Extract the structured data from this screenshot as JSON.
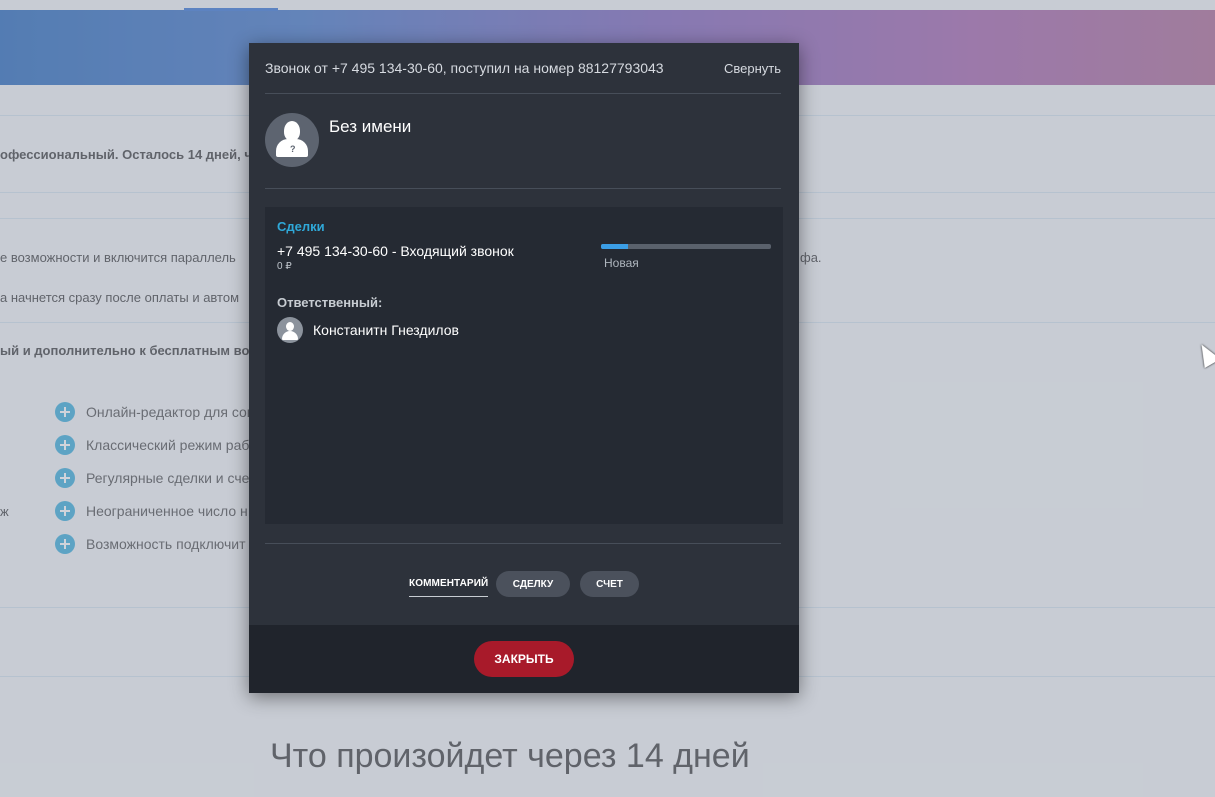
{
  "background": {
    "trial_notice": "офессиональный. Осталось 14 дней, чт",
    "line1": "е возможности и включится параллель",
    "line1_right": "фа.",
    "line2": "а начнется сразу после оплаты и автом",
    "line3": "ый и дополнительно к бесплатным во",
    "side_label": "ж",
    "features": [
      "Онлайн-редактор для сов",
      "Классический режим раб",
      "Регулярные сделки и счет",
      "Неограниченное число н",
      "Возможность подключит"
    ],
    "heading": "Что произойдет через 14 дней"
  },
  "call_modal": {
    "title": "Звонок от +7 495 134-30-60, поступил на номер 88127793043",
    "collapse_label": "Свернуть",
    "contact_name": "Без имени",
    "deals": {
      "section_title": "Сделки",
      "deal_name": "+7 495 134-30-60 - Входящий звонок",
      "deal_sum": "0 ₽",
      "stage": "Новая",
      "stage_progress": 0.16,
      "responsible_label": "Ответственный:",
      "responsible_name": "Констанитн Гнездилов"
    },
    "actions": {
      "comment": "КОММЕНТАРИЙ",
      "deal": "СДЕЛКУ",
      "invoice": "СЧЕТ"
    },
    "close_label": "ЗАКРЫТЬ"
  }
}
